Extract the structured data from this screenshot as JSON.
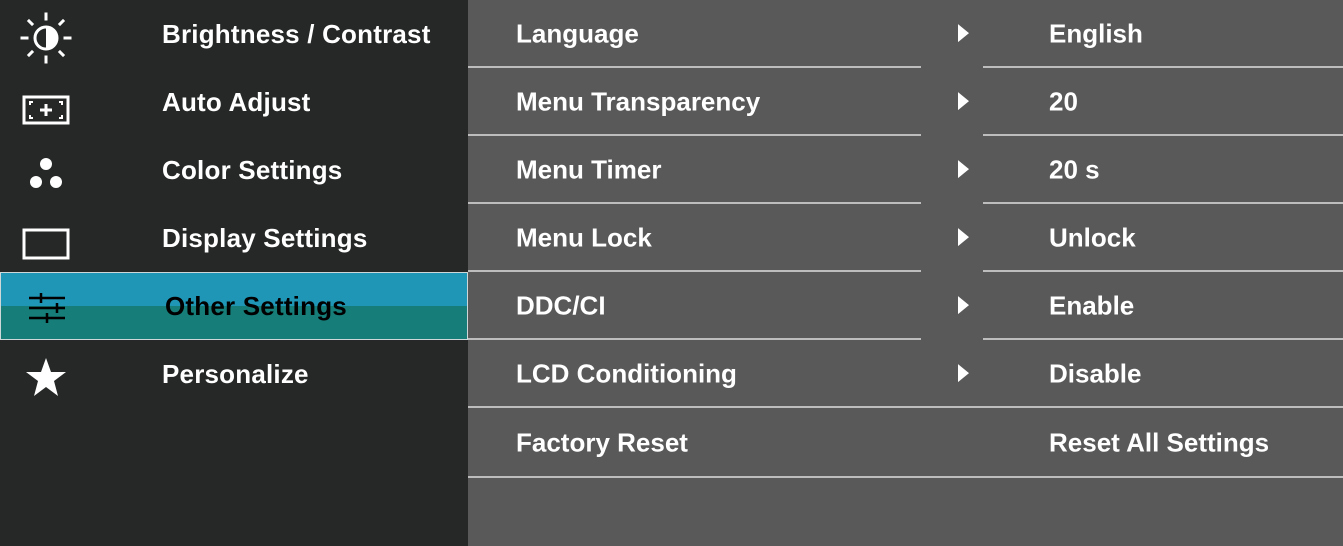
{
  "sidebar": {
    "items": [
      {
        "label": "Brightness / Contrast",
        "icon": "brightness-icon"
      },
      {
        "label": "Auto Adjust",
        "icon": "auto-adjust-icon"
      },
      {
        "label": "Color Settings",
        "icon": "color-dots-icon"
      },
      {
        "label": "Display Settings",
        "icon": "display-rectangle-icon"
      },
      {
        "label": "Other Settings",
        "icon": "sliders-icon",
        "selected": true
      },
      {
        "label": "Personalize",
        "icon": "star-icon"
      }
    ]
  },
  "panel": {
    "rows": [
      {
        "name": "Language",
        "value": "English",
        "has_submenu": true
      },
      {
        "name": "Menu Transparency",
        "value": "20",
        "has_submenu": true
      },
      {
        "name": "Menu Timer",
        "value": "20 s",
        "has_submenu": true
      },
      {
        "name": "Menu Lock",
        "value": "Unlock",
        "has_submenu": true
      },
      {
        "name": "DDC/CI",
        "value": "Enable",
        "has_submenu": true
      },
      {
        "name": "LCD Conditioning",
        "value": "Disable",
        "has_submenu": true
      },
      {
        "name": "Factory Reset",
        "value": "Reset All Settings",
        "has_submenu": false
      }
    ]
  },
  "colors": {
    "sidebar_bg": "#262828",
    "panel_bg": "#595959",
    "selected_top": "#1f96b5",
    "selected_bottom": "#167d78",
    "separator": "#bdbdbd",
    "text": "#ffffff"
  }
}
